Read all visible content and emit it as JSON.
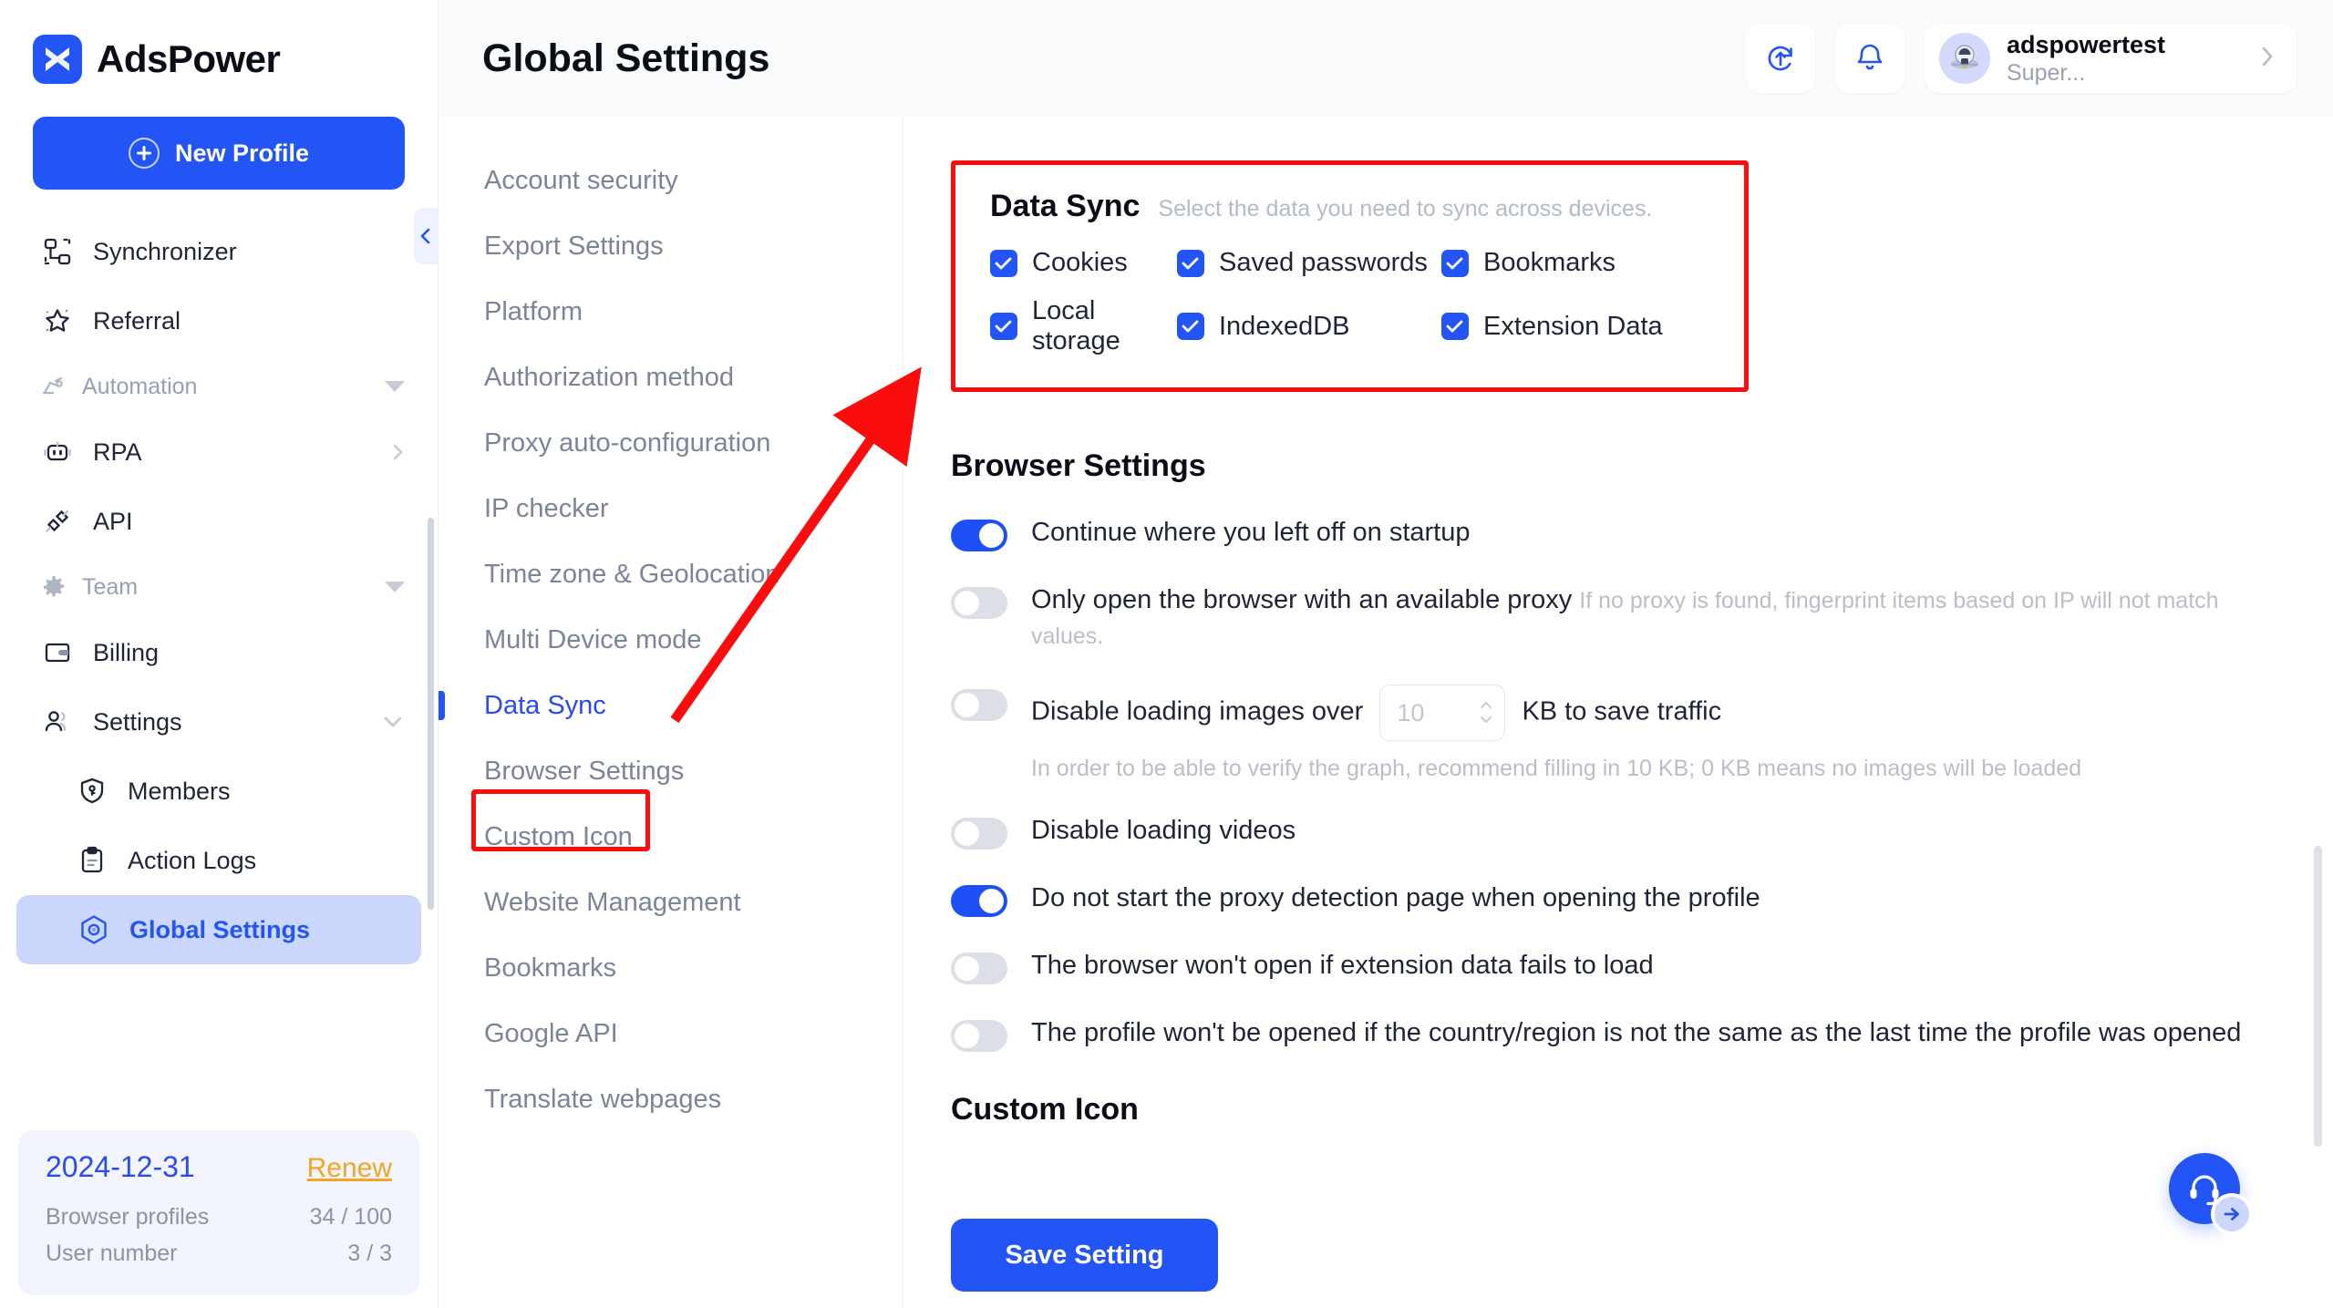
{
  "brand": {
    "name": "AdsPower",
    "logo_icon": "adspower-logo-icon"
  },
  "sidebar": {
    "new_profile_label": "New Profile",
    "collapse_icon": "chevron-left-icon",
    "items": [
      {
        "label": "Synchronizer",
        "icon": "synchronizer-icon",
        "type": "item"
      },
      {
        "label": "Referral",
        "icon": "star-icon",
        "type": "item"
      },
      {
        "label": "Automation",
        "icon": "automation-icon",
        "type": "group",
        "expand_icon": "caret-down-icon"
      },
      {
        "label": "RPA",
        "icon": "robot-icon",
        "type": "item",
        "expand_icon": "chevron-right-icon"
      },
      {
        "label": "API",
        "icon": "plug-icon",
        "type": "item"
      },
      {
        "label": "Team",
        "icon": "gear-icon",
        "type": "group",
        "expand_icon": "caret-down-icon"
      },
      {
        "label": "Billing",
        "icon": "wallet-icon",
        "type": "item"
      },
      {
        "label": "Settings",
        "icon": "users-icon",
        "type": "item",
        "expand_icon": "chevron-down-icon"
      },
      {
        "label": "Members",
        "icon": "shield-key-icon",
        "type": "sub"
      },
      {
        "label": "Action Logs",
        "icon": "clipboard-icon",
        "type": "sub"
      },
      {
        "label": "Global Settings",
        "icon": "hexagon-icon",
        "type": "sub",
        "active": true
      }
    ],
    "subscription": {
      "expiry_date": "2024-12-31",
      "renew_label": "Renew",
      "rows": [
        {
          "label": "Browser profiles",
          "value": "34 / 100"
        },
        {
          "label": "User number",
          "value": "3 / 3"
        }
      ]
    }
  },
  "topbar": {
    "title": "Global Settings",
    "sync_icon": "sync-upload-icon",
    "bell_icon": "bell-icon",
    "user": {
      "name": "adspowertest",
      "role": "Super...",
      "avatar_icon": "astronaut-avatar-icon",
      "chevron_icon": "chevron-right-icon"
    }
  },
  "settings_menu": {
    "items": [
      {
        "label": "Account security"
      },
      {
        "label": "Export Settings"
      },
      {
        "label": "Platform"
      },
      {
        "label": "Authorization method"
      },
      {
        "label": "Proxy auto-configuration"
      },
      {
        "label": "IP checker"
      },
      {
        "label": "Time zone & Geolocation"
      },
      {
        "label": "Multi Device mode"
      },
      {
        "label": "Data Sync",
        "active": true,
        "highlighted": true
      },
      {
        "label": "Browser Settings"
      },
      {
        "label": "Custom Icon"
      },
      {
        "label": "Website Management"
      },
      {
        "label": "Bookmarks"
      },
      {
        "label": "Google API"
      },
      {
        "label": "Translate webpages"
      }
    ]
  },
  "data_sync": {
    "title": "Data Sync",
    "subtitle": "Select the data you need to sync across devices.",
    "highlighted": true,
    "options": [
      {
        "label": "Cookies",
        "checked": true
      },
      {
        "label": "Saved passwords",
        "checked": true
      },
      {
        "label": "Bookmarks",
        "checked": true
      },
      {
        "label": "Local storage",
        "checked": true
      },
      {
        "label": "IndexedDB",
        "checked": true
      },
      {
        "label": "Extension Data",
        "checked": true
      }
    ]
  },
  "browser_settings": {
    "title": "Browser Settings",
    "toggles": [
      {
        "label": "Continue where you left off on startup",
        "on": true
      },
      {
        "label": "Only open the browser with an available proxy",
        "on": false,
        "hint": "If no proxy is found, fingerprint items based on IP will not match values."
      },
      {
        "label_before": "Disable loading images over",
        "label_after": "KB to save traffic",
        "on": false,
        "input_value": "10",
        "hint": "In order to be able to verify the graph, recommend filling in 10 KB; 0 KB means no images will be loaded"
      },
      {
        "label": "Disable loading videos",
        "on": false
      },
      {
        "label": "Do not start the proxy detection page when opening the profile",
        "on": true
      },
      {
        "label": "The browser won't open if extension data fails to load",
        "on": false
      },
      {
        "label": "The profile won't be opened if the country/region is not the same as the last time the profile was opened",
        "on": false
      }
    ]
  },
  "custom_icon_section": {
    "title": "Custom Icon"
  },
  "footer": {
    "save_label": "Save Setting"
  },
  "support": {
    "icon": "headset-icon",
    "badge_icon": "arrow-right-icon"
  },
  "annotation": {
    "arrow_color": "#fb0d0d",
    "box_color": "#fb0d0d"
  }
}
